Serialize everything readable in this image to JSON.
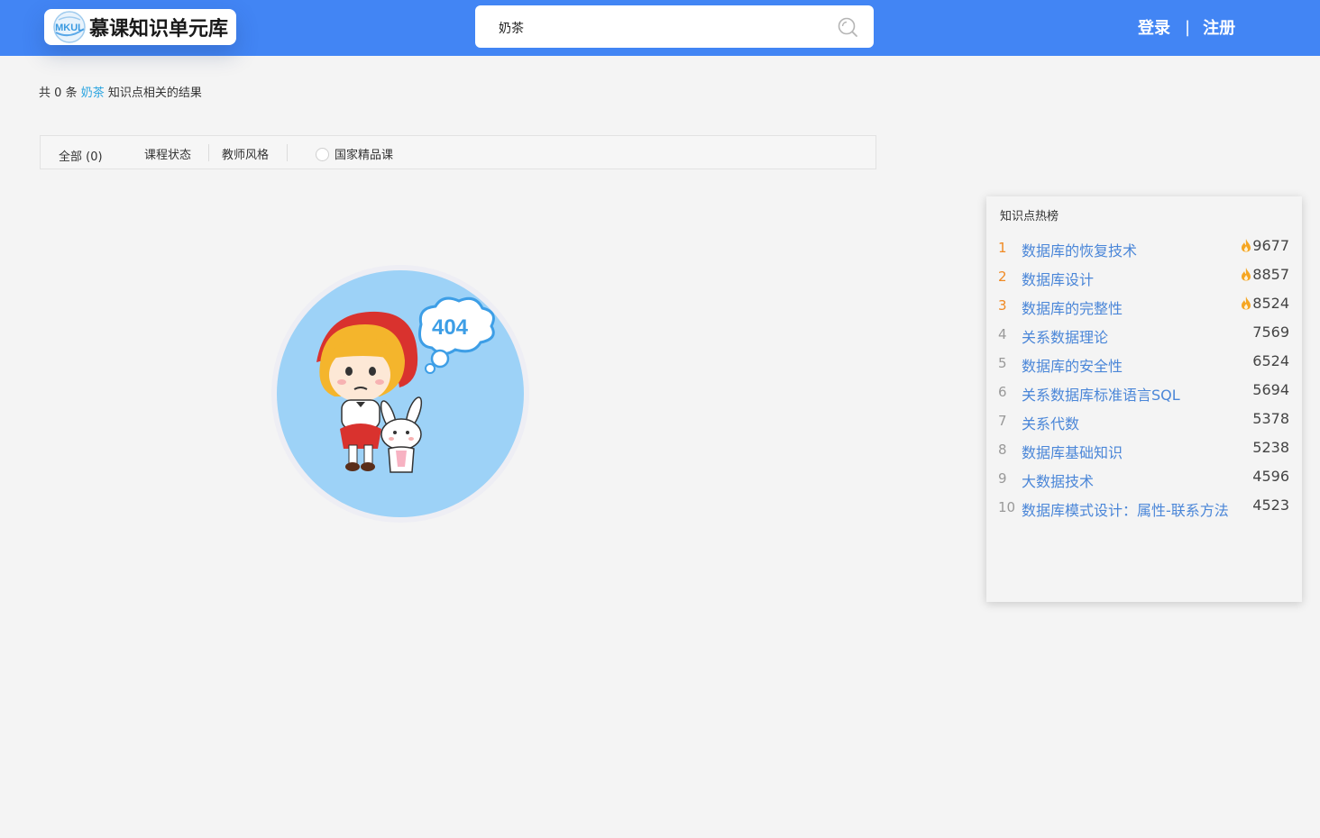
{
  "header": {
    "logo_text": "慕课知识单元库",
    "logo_badge_text": "MKUL",
    "search_value": "奶茶",
    "login": "登录",
    "separator": "|",
    "register": "注册"
  },
  "results": {
    "prefix": "共",
    "count": "0",
    "unit": "条",
    "keyword": "奶茶",
    "suffix": "知识点相关的结果"
  },
  "filters": {
    "all": "全部 (0)",
    "status": "课程状态",
    "style": "教师风格",
    "national": "国家精品课"
  },
  "illustration": {
    "code": "404"
  },
  "colors": {
    "header": "#4285f4",
    "link": "#4a86d8",
    "hot_rank": "#f08a24",
    "keyword": "#2aa4e0"
  },
  "hot": {
    "title": "知识点热榜",
    "items": [
      {
        "rank": "1",
        "name": "数据库的恢复技术",
        "count": "9677",
        "hot": true
      },
      {
        "rank": "2",
        "name": "数据库设计",
        "count": "8857",
        "hot": true
      },
      {
        "rank": "3",
        "name": "数据库的完整性",
        "count": "8524",
        "hot": true
      },
      {
        "rank": "4",
        "name": "关系数据理论",
        "count": "7569",
        "hot": false
      },
      {
        "rank": "5",
        "name": "数据库的安全性",
        "count": "6524",
        "hot": false
      },
      {
        "rank": "6",
        "name": "关系数据库标准语言SQL",
        "count": "5694",
        "hot": false
      },
      {
        "rank": "7",
        "name": "关系代数",
        "count": "5378",
        "hot": false
      },
      {
        "rank": "8",
        "name": "数据库基础知识",
        "count": "5238",
        "hot": false
      },
      {
        "rank": "9",
        "name": "大数据技术",
        "count": "4596",
        "hot": false
      },
      {
        "rank": "10",
        "name": "数据库模式设计：属性-联系方法",
        "count": "4523",
        "hot": false
      }
    ]
  }
}
